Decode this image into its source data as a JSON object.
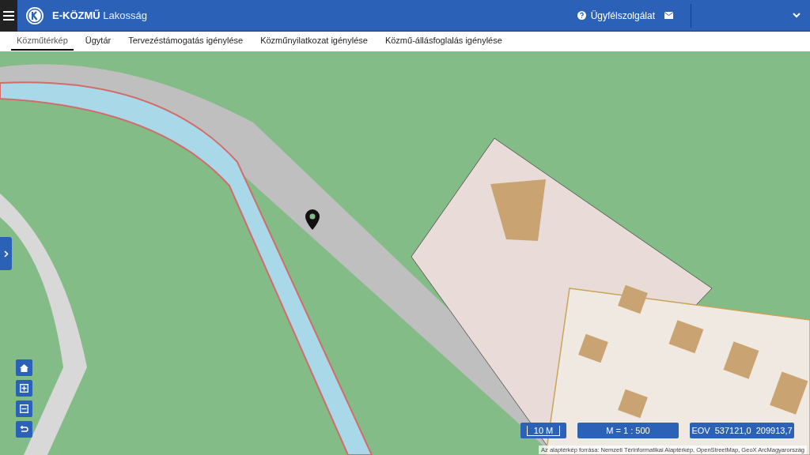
{
  "header": {
    "brand_bold": "E-KÖZMŰ",
    "brand_light": "Lakosság",
    "support": "Ügyfélszolgálat"
  },
  "tabs": [
    {
      "label": "Közműtérkép",
      "selected": true
    },
    {
      "label": "Ügytár",
      "selected": false
    },
    {
      "label": "Tervezéstámogatás igénylése",
      "selected": false
    },
    {
      "label": "Közműnyilatkozat igénylése",
      "selected": false
    },
    {
      "label": "Közmű-állásfoglalás igénylése",
      "selected": false
    }
  ],
  "map": {
    "scale_bar": "10 M",
    "scale": "M = 1 : 500",
    "coordinates": "EOV  537121,0  209913,7",
    "attribution": "Az alaptérkép forrása: Nemzeti Térinformatikai Alaptérkép, OpenStreetMap, GeoX ArcMagyarország"
  }
}
